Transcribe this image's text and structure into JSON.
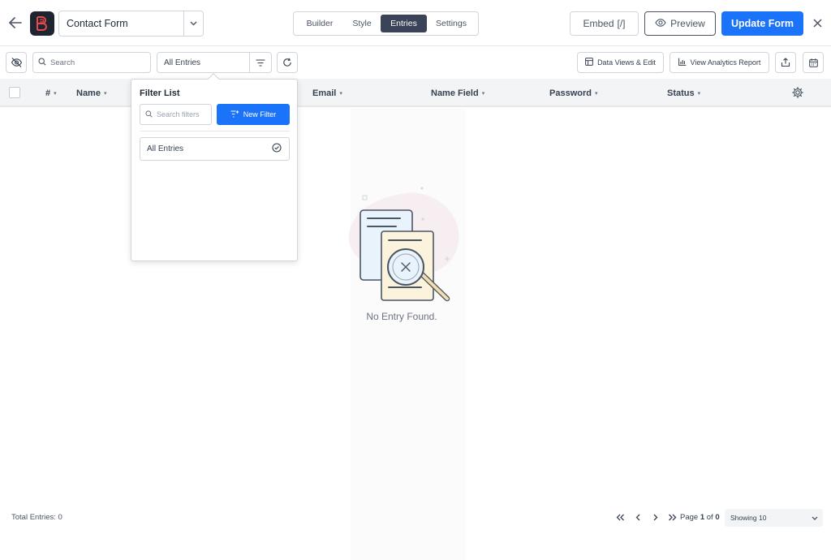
{
  "header": {
    "form_name": "Contact Form",
    "tabs": [
      {
        "label": "Builder",
        "active": false
      },
      {
        "label": "Style",
        "active": false
      },
      {
        "label": "Entries",
        "active": true
      },
      {
        "label": "Settings",
        "active": false
      }
    ],
    "embed_label": "Embed",
    "embed_glyph": "[/]",
    "preview_label": "Preview",
    "update_label": "Update Form"
  },
  "toolbar": {
    "search_placeholder": "Search",
    "entries_filter": "All Entries",
    "data_views_label": "Data Views & Edit",
    "analytics_label": "View Analytics Report"
  },
  "table": {
    "columns": [
      {
        "label": "#"
      },
      {
        "label": "Name"
      },
      {
        "label": "Email"
      },
      {
        "label": "Name Field"
      },
      {
        "label": "Password"
      },
      {
        "label": "Status"
      }
    ],
    "sort_glyph": "▾",
    "empty_message": "No Entry Found."
  },
  "filter_popover": {
    "title": "Filter List",
    "search_placeholder": "Search filters",
    "new_filter_label": "New Filter",
    "items": [
      {
        "label": "All Entries",
        "selected": true
      }
    ]
  },
  "footer": {
    "total_label": "Total Entries: 0",
    "page_prefix": "Page",
    "page_current": "1",
    "page_of": "of",
    "page_total": "0",
    "showing_label": "Showing 10"
  },
  "colors": {
    "primary": "#1a73f8",
    "active_tab": "#3a4358",
    "logo_bg": "#1e2430",
    "logo_accent": "#e64a4a",
    "header_bg": "#f3f4f6",
    "border": "#d1d5db"
  },
  "icons": [
    "back-arrow-icon",
    "brand-logo-icon",
    "chevron-down-icon",
    "eye-icon",
    "close-icon",
    "eye-off-icon",
    "search-icon",
    "filter-lines-icon",
    "refresh-icon",
    "table-icon",
    "bar-chart-icon",
    "export-icon",
    "calendar-icon",
    "gear-icon",
    "check-circle-icon",
    "first-page-icon",
    "prev-page-icon",
    "next-page-icon",
    "last-page-icon"
  ]
}
